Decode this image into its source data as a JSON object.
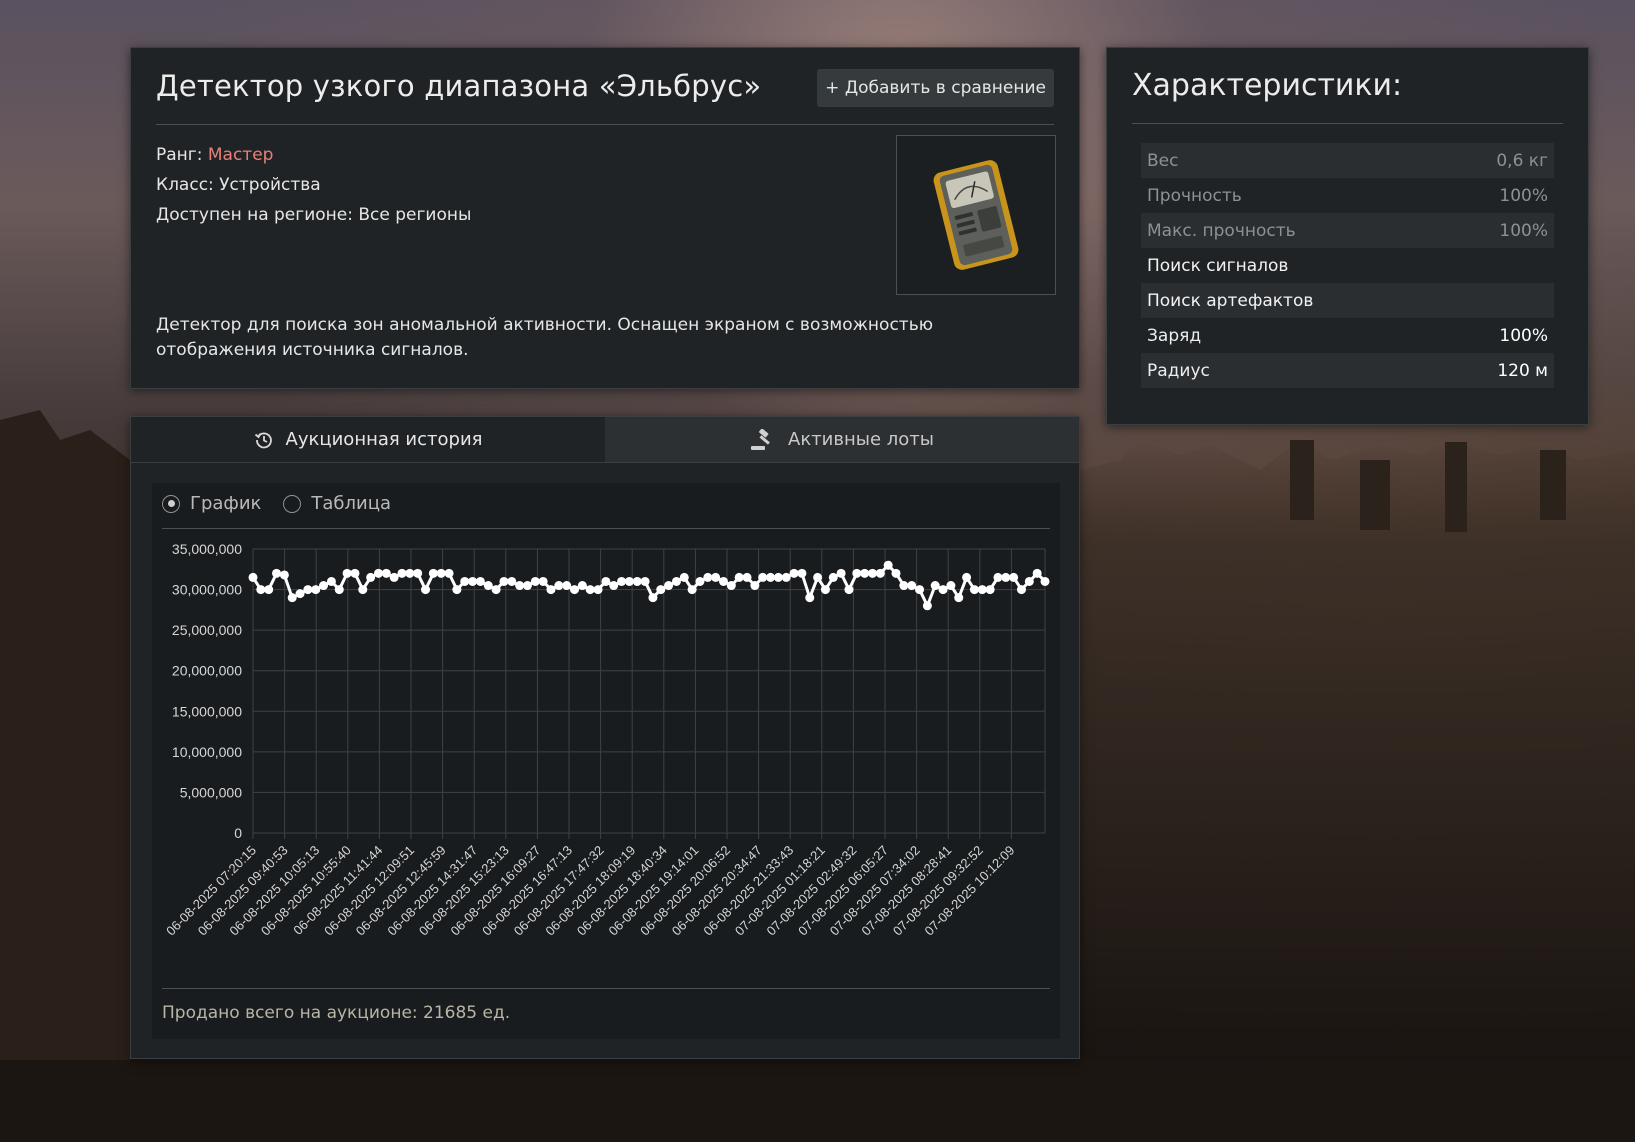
{
  "item": {
    "title": "Детектор узкого диапазона «Эльбрус»",
    "compare_label": "+ Добавить в сравнение",
    "rank_label": "Ранг:",
    "rank_value": "Мастер",
    "class_text": "Класс: Устройства",
    "region_text": "Доступен на регионе: Все регионы",
    "description": "Детектор для поиска зон аномальной активности. Оснащен экраном с возможностью отображения источника сигналов.",
    "image_icon": "detector-device-icon"
  },
  "stats": {
    "title": "Характеристики:",
    "rows": [
      {
        "name": "Вес",
        "value": "0,6 кг",
        "style": "dim"
      },
      {
        "name": "Прочность",
        "value": "100%",
        "style": "dim"
      },
      {
        "name": "Макс. прочность",
        "value": "100%",
        "style": "dim"
      },
      {
        "name": "Поиск сигналов",
        "value": "",
        "style": "heading"
      },
      {
        "name": "Поиск артефактов",
        "value": "",
        "style": "heading"
      },
      {
        "name": "Заряд",
        "value": "100%",
        "style": "bright"
      },
      {
        "name": "Радиус",
        "value": "120 м",
        "style": "bright"
      }
    ]
  },
  "tabs": [
    {
      "label": "Аукционная история",
      "icon": "history-icon",
      "active": true
    },
    {
      "label": "Активные лоты",
      "icon": "gavel-icon",
      "active": false
    }
  ],
  "view_toggle": {
    "options": [
      {
        "label": "График",
        "checked": true
      },
      {
        "label": "Таблица",
        "checked": false
      }
    ]
  },
  "sold_total": "Продано всего на аукционе: 21685 ед.",
  "colors": {
    "panel_bg": "#1f2325",
    "chart_bg": "#191c1e",
    "rank_color": "#e8807a",
    "line_color": "#ffffff"
  },
  "chart_data": {
    "type": "line",
    "title": "",
    "xlabel": "",
    "ylabel": "",
    "ylim": [
      0,
      35000000
    ],
    "y_ticks": [
      "35,000,000",
      "30,000,000",
      "25,000,000",
      "20,000,000",
      "15,000,000",
      "10,000,000",
      "5,000,000",
      "0"
    ],
    "x_tick_labels": [
      "06-08-2025 07:20:15",
      "06-08-2025 09:40:53",
      "06-08-2025 10:05:13",
      "06-08-2025 10:55:40",
      "06-08-2025 11:41:44",
      "06-08-2025 12:09:51",
      "06-08-2025 12:45:59",
      "06-08-2025 14:31:47",
      "06-08-2025 15:23:13",
      "06-08-2025 16:09:27",
      "06-08-2025 16:47:13",
      "06-08-2025 17:47:32",
      "06-08-2025 18:09:19",
      "06-08-2025 18:40:34",
      "06-08-2025 19:14:01",
      "06-08-2025 20:06:52",
      "06-08-2025 20:34:47",
      "06-08-2025 21:33:43",
      "07-08-2025 01:18:21",
      "07-08-2025 02:49:32",
      "07-08-2025 06:05:27",
      "07-08-2025 07:34:02",
      "07-08-2025 08:28:41",
      "07-08-2025 09:32:52",
      "07-08-2025 10:12:09"
    ],
    "series": [
      {
        "values": [
          31500000,
          30000000,
          30000000,
          32000000,
          31800000,
          29000000,
          29500000,
          30000000,
          30000000,
          30500000,
          31000000,
          30000000,
          32000000,
          32000000,
          30000000,
          31500000,
          32000000,
          32000000,
          31500000,
          32000000,
          32000000,
          32000000,
          30000000,
          32000000,
          32000000,
          32000000,
          30000000,
          31000000,
          31000000,
          31000000,
          30500000,
          30000000,
          31000000,
          31000000,
          30500000,
          30500000,
          31000000,
          31000000,
          30000000,
          30500000,
          30500000,
          30000000,
          30500000,
          30000000,
          30000000,
          31000000,
          30500000,
          31000000,
          31000000,
          31000000,
          31000000,
          29000000,
          30000000,
          30500000,
          31000000,
          31500000,
          30000000,
          31000000,
          31500000,
          31500000,
          31000000,
          30500000,
          31500000,
          31500000,
          30500000,
          31500000,
          31500000,
          31500000,
          31500000,
          32000000,
          32000000,
          29000000,
          31500000,
          30000000,
          31500000,
          32000000,
          30000000,
          32000000,
          32000000,
          32000000,
          32000000,
          33000000,
          32000000,
          30500000,
          30500000,
          30000000,
          28000000,
          30500000,
          30000000,
          30500000,
          29000000,
          31500000,
          30000000,
          30000000,
          30000000,
          31500000,
          31500000,
          31500000,
          30000000,
          31000000,
          32000000,
          31000000
        ]
      }
    ]
  }
}
